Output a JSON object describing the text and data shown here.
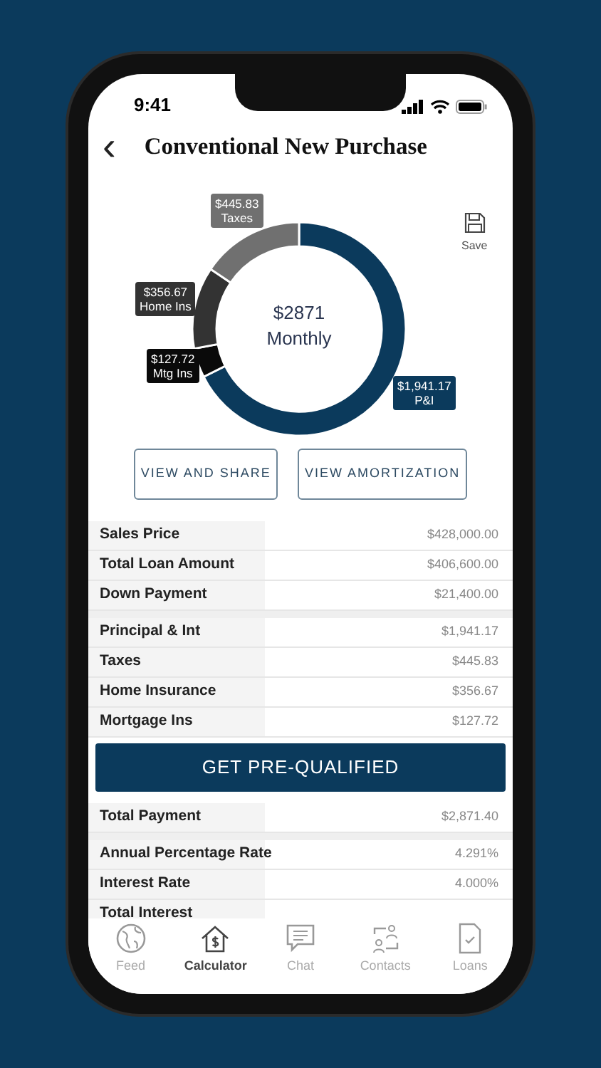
{
  "status_bar": {
    "time": "9:41"
  },
  "header": {
    "back": "‹",
    "title": "Conventional New Purchase"
  },
  "chart": {
    "center_amount": "$2871",
    "center_label": "Monthly",
    "save_label": "Save",
    "chart_data": {
      "type": "donut",
      "categories": [
        "P&I",
        "Mtg Ins",
        "Home Ins",
        "Taxes"
      ],
      "series": [
        {
          "values": [
            67.6,
            4.45,
            12.42,
            15.53
          ]
        }
      ],
      "colors": [
        "#0b3a5c",
        "#0a0a0a",
        "#333333",
        "#707070"
      ],
      "value_labels": [
        "$1,941.17",
        "$127.72",
        "$356.67",
        "$445.83"
      ]
    }
  },
  "actions": [
    "VIEW AND SHARE",
    "VIEW AMORTIZATION"
  ],
  "sections": [
    {
      "kind": "rows",
      "rows": [
        {
          "label": "Sales Price",
          "value": "$428,000.00"
        },
        {
          "label": "Total Loan Amount",
          "value": "$406,600.00"
        },
        {
          "label": "Down Payment",
          "value": "$21,400.00"
        }
      ]
    },
    {
      "kind": "rows",
      "rows": [
        {
          "label": "Principal & Int",
          "value": "$1,941.17"
        },
        {
          "label": "Taxes",
          "value": "$445.83"
        },
        {
          "label": "Home Insurance",
          "value": "$356.67"
        },
        {
          "label": "Mortgage Ins",
          "value": "$127.72"
        }
      ]
    },
    {
      "kind": "button",
      "label": "GET PRE-QUALIFIED"
    },
    {
      "kind": "rows",
      "rows": [
        {
          "label": "Total Payment",
          "value": "$2,871.40"
        }
      ]
    },
    {
      "kind": "rows",
      "rows": [
        {
          "label": "Annual Percentage Rate",
          "value": "4.291%"
        },
        {
          "label": "Interest Rate",
          "value": "4.000%"
        },
        {
          "label": "Total Interest"
        }
      ]
    }
  ],
  "tabs": [
    {
      "label": "Feed",
      "selected": false
    },
    {
      "label": "Calculator",
      "selected": true
    },
    {
      "label": "Chat",
      "selected": false
    },
    {
      "label": "Contacts",
      "selected": false
    },
    {
      "label": "Loans",
      "selected": false
    }
  ]
}
